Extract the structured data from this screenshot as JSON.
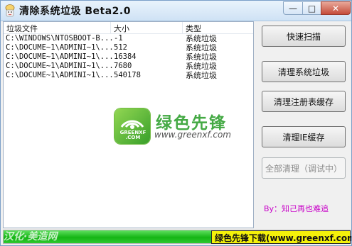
{
  "window": {
    "title": "清除系统垃圾 Beta2.0",
    "minimize_glyph": "—",
    "maximize_glyph": "□",
    "close_glyph": "✕"
  },
  "list": {
    "columns": [
      "垃圾文件",
      "大小",
      "类型"
    ],
    "rows": [
      {
        "file": "C:\\WINDOWS\\NTOSBOOT-B...",
        "size": "-1",
        "type": "系统垃圾"
      },
      {
        "file": "C:\\DOCUME~1\\ADMINI~1\\...",
        "size": "512",
        "type": "系统垃圾"
      },
      {
        "file": "C:\\DOCUME~1\\ADMINI~1\\...",
        "size": "16384",
        "type": "系统垃圾"
      },
      {
        "file": "C:\\DOCUME~1\\ADMINI~1\\...",
        "size": "7680",
        "type": "系统垃圾"
      },
      {
        "file": "C:\\DOCUME~1\\ADMINI~1\\...",
        "size": "540178",
        "type": "系统垃圾"
      }
    ]
  },
  "watermark": {
    "brand_cn": "绿色先锋",
    "url": "www.greenxf.com",
    "badge_text_1": "GREENXF",
    "badge_text_2": ".COM",
    "left_text": "汉化·美造网"
  },
  "buttons": {
    "quick_scan": "快速扫描",
    "clean_system": "清理系统垃圾",
    "clean_registry": "清理注册表缓存",
    "clean_ie": "清理IE缓存",
    "clean_all": "全部清理（调试中）"
  },
  "author_label": "By：知己再也难追",
  "progress": {
    "value": 1.0
  },
  "banner": {
    "text": "绿色先锋下载(www.greenxf.com)"
  },
  "colors": {
    "progress": "#15b515",
    "banner": "#f4f10a",
    "author": "#c800c8",
    "watermark_green": "#3aa53a"
  }
}
